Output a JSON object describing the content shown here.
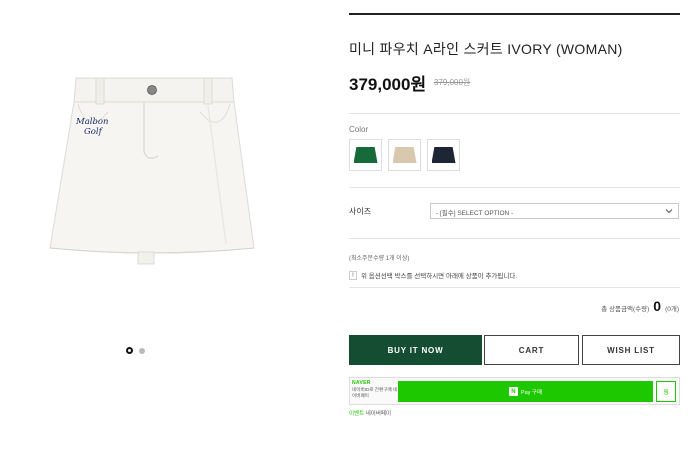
{
  "product": {
    "title": "미니 파우치 A라인 스커트 IVORY (WOMAN)",
    "price": "379,000원",
    "original_price": "379,000원",
    "image_icon": "white-mini-skirt-image",
    "logo_text": "Malbon Golf"
  },
  "gallery": {
    "slides": 2,
    "active_slide": 1
  },
  "colors": {
    "label": "Color",
    "swatches": [
      {
        "name": "green",
        "hex": "#176a3a"
      },
      {
        "name": "beige",
        "hex": "#d8c8ad"
      },
      {
        "name": "navy",
        "hex": "#1e2535"
      }
    ]
  },
  "size": {
    "label": "사이즈",
    "selected": "- [필수] SELECT OPTION -"
  },
  "min_qty": "(최소주문수량 1개 이상)",
  "notice": {
    "badge": "!",
    "text": "위 옵션선택 박스를 선택하시면 아래에 상품이 추가됩니다."
  },
  "total": {
    "label": "총 상품금액(수량)",
    "qty": "0",
    "unit": "(0개)"
  },
  "buttons": {
    "buy": "BUY IT NOW",
    "cart": "CART",
    "wish": "WISH LIST"
  },
  "naver_pay": {
    "brand": "NAVER",
    "desc": "네이버ID로 간편구매 네이버페이",
    "n_mark": "N",
    "pay_label": "Pay 구매",
    "wish_label": "찜",
    "events_label": "이벤트",
    "events_text": "네이버페이"
  },
  "colors_theme": {
    "buy_green": "#144d32",
    "naver_green": "#1ec800"
  }
}
